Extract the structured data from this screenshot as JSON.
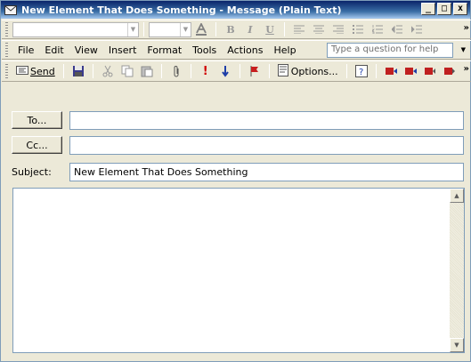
{
  "window": {
    "title": "New Element That Does Something - Message (Plain Text)",
    "controls": {
      "minimize": "_",
      "maximize": "□",
      "close": "x"
    }
  },
  "format_toolbar": {
    "font_name": "",
    "font_size": "",
    "bold": "B",
    "italic": "I",
    "underline": "U",
    "more": "»"
  },
  "menu": {
    "items": [
      "File",
      "Edit",
      "View",
      "Insert",
      "Format",
      "Tools",
      "Actions",
      "Help"
    ],
    "help_placeholder": "Type a question for help"
  },
  "standard_toolbar": {
    "send_label": "Send",
    "options_label": "Options...",
    "more": "»"
  },
  "fields": {
    "to_button": "To...",
    "to_value": "",
    "cc_button": "Cc...",
    "cc_value": "",
    "subject_label": "Subject:",
    "subject_value": "New Element That Does Something"
  },
  "body": {
    "text": ""
  },
  "colors": {
    "title_bar": "#0a246a",
    "chrome": "#ece9d8",
    "field_border": "#7f9db9"
  }
}
